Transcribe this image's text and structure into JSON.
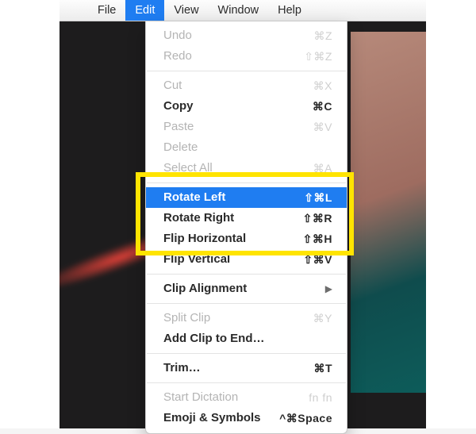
{
  "menubar": {
    "apple_icon": "",
    "items": [
      {
        "label": "File",
        "active": false
      },
      {
        "label": "Edit",
        "active": true
      },
      {
        "label": "View",
        "active": false
      },
      {
        "label": "Window",
        "active": false
      },
      {
        "label": "Help",
        "active": false
      }
    ]
  },
  "menu": {
    "undo": {
      "label": "Undo",
      "shortcut": "⌘Z"
    },
    "redo": {
      "label": "Redo",
      "shortcut": "⇧⌘Z"
    },
    "cut": {
      "label": "Cut",
      "shortcut": "⌘X"
    },
    "copy": {
      "label": "Copy",
      "shortcut": "⌘C"
    },
    "paste": {
      "label": "Paste",
      "shortcut": "⌘V"
    },
    "delete": {
      "label": "Delete",
      "shortcut": ""
    },
    "select_all": {
      "label": "Select All",
      "shortcut": "⌘A"
    },
    "rotate_left": {
      "label": "Rotate Left",
      "shortcut": "⇧⌘L"
    },
    "rotate_right": {
      "label": "Rotate Right",
      "shortcut": "⇧⌘R"
    },
    "flip_horizontal": {
      "label": "Flip Horizontal",
      "shortcut": "⇧⌘H"
    },
    "flip_vertical": {
      "label": "Flip Vertical",
      "shortcut": "⇧⌘V"
    },
    "clip_alignment": {
      "label": "Clip Alignment",
      "shortcut": ""
    },
    "split_clip": {
      "label": "Split Clip",
      "shortcut": "⌘Y"
    },
    "add_clip": {
      "label": "Add Clip to End…",
      "shortcut": ""
    },
    "trim": {
      "label": "Trim…",
      "shortcut": "⌘T"
    },
    "start_dictation": {
      "label": "Start Dictation",
      "shortcut": "fn fn"
    },
    "emoji": {
      "label": "Emoji & Symbols",
      "shortcut": "^⌘Space"
    }
  },
  "highlight": {
    "color": "#ffe400"
  }
}
